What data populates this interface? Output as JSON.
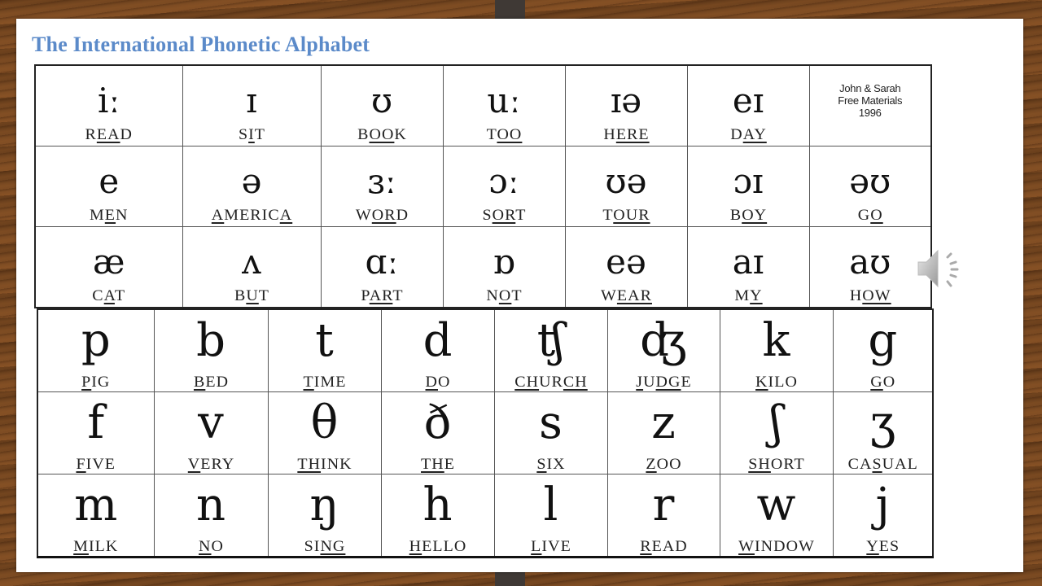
{
  "slide": {
    "title": "The International Phonetic Alphabet",
    "credit": [
      "John & Sarah",
      "Free Materials",
      "1996"
    ]
  },
  "vowels": [
    [
      {
        "symbol": "iː",
        "word": [
          "R",
          "EA",
          "D"
        ]
      },
      {
        "symbol": "ɪ",
        "word": [
          "S",
          "I",
          "T"
        ]
      },
      {
        "symbol": "ʊ",
        "word": [
          "B",
          "OO",
          "K"
        ]
      },
      {
        "symbol": "uː",
        "word": [
          "T",
          "OO",
          ""
        ]
      },
      {
        "symbol": "ɪə",
        "word": [
          "H",
          "ERE",
          ""
        ]
      },
      {
        "symbol": "eɪ",
        "word": [
          "D",
          "AY",
          ""
        ]
      },
      {
        "credit": true
      }
    ],
    [
      {
        "symbol": "e",
        "word": [
          "M",
          "E",
          "N"
        ]
      },
      {
        "symbol": "ə",
        "word": [
          "",
          "A",
          "MERIC",
          "A",
          ""
        ]
      },
      {
        "symbol": "ɜː",
        "word": [
          "W",
          "OR",
          "D"
        ]
      },
      {
        "symbol": "ɔː",
        "word": [
          "S",
          "OR",
          "T"
        ]
      },
      {
        "symbol": "ʊə",
        "word": [
          "T",
          "OUR",
          ""
        ]
      },
      {
        "symbol": "ɔɪ",
        "word": [
          "B",
          "OY",
          ""
        ]
      },
      {
        "symbol": "əʊ",
        "word": [
          "G",
          "O",
          ""
        ]
      }
    ],
    [
      {
        "symbol": "æ",
        "word": [
          "C",
          "A",
          "T"
        ]
      },
      {
        "symbol": "ʌ",
        "word": [
          "B",
          "U",
          "T"
        ]
      },
      {
        "symbol": "ɑː",
        "word": [
          "P",
          "AR",
          "T"
        ]
      },
      {
        "symbol": "ɒ",
        "word": [
          "N",
          "O",
          "T"
        ]
      },
      {
        "symbol": "eə",
        "word": [
          "W",
          "EAR",
          ""
        ]
      },
      {
        "symbol": "aɪ",
        "word": [
          "M",
          "Y",
          ""
        ]
      },
      {
        "symbol": "aʊ",
        "word": [
          "H",
          "OW",
          ""
        ]
      }
    ]
  ],
  "consonants": [
    [
      {
        "symbol": "p",
        "word": [
          "",
          "P",
          "IG"
        ]
      },
      {
        "symbol": "b",
        "word": [
          "",
          "B",
          "ED"
        ]
      },
      {
        "symbol": "t",
        "word": [
          "",
          "T",
          "IME"
        ]
      },
      {
        "symbol": "d",
        "word": [
          "",
          "D",
          "O"
        ]
      },
      {
        "symbol": "ʧ",
        "word": [
          "",
          "CH",
          "UR",
          "CH",
          ""
        ]
      },
      {
        "symbol": "ʤ",
        "word": [
          "",
          "J",
          "U",
          "DG",
          "E"
        ]
      },
      {
        "symbol": "k",
        "word": [
          "",
          "K",
          "ILO"
        ]
      },
      {
        "symbol": "g",
        "word": [
          "",
          "G",
          "O"
        ]
      }
    ],
    [
      {
        "symbol": "f",
        "word": [
          "",
          "F",
          "IVE"
        ]
      },
      {
        "symbol": "v",
        "word": [
          "",
          "V",
          "ERY"
        ]
      },
      {
        "symbol": "θ",
        "word": [
          "",
          "TH",
          "INK"
        ]
      },
      {
        "symbol": "ð",
        "word": [
          "",
          "TH",
          "E"
        ]
      },
      {
        "symbol": "s",
        "word": [
          "",
          "S",
          "IX"
        ]
      },
      {
        "symbol": "z",
        "word": [
          "",
          "Z",
          "OO"
        ]
      },
      {
        "symbol": "ʃ",
        "word": [
          "",
          "SH",
          "ORT"
        ]
      },
      {
        "symbol": "ʒ",
        "word": [
          "CA",
          "S",
          "UAL"
        ]
      }
    ],
    [
      {
        "symbol": "m",
        "word": [
          "",
          "M",
          "ILK"
        ]
      },
      {
        "symbol": "n",
        "word": [
          "",
          "N",
          "O"
        ]
      },
      {
        "symbol": "ŋ",
        "word": [
          "SI",
          "NG",
          ""
        ]
      },
      {
        "symbol": "h",
        "word": [
          "",
          "H",
          "ELLO"
        ]
      },
      {
        "symbol": "l",
        "word": [
          "",
          "L",
          "IVE"
        ]
      },
      {
        "symbol": "r",
        "word": [
          "",
          "R",
          "EAD"
        ]
      },
      {
        "symbol": "w",
        "word": [
          "",
          "W",
          "INDOW"
        ]
      },
      {
        "symbol": "j",
        "word": [
          "",
          "Y",
          "ES"
        ]
      }
    ]
  ],
  "audio": {
    "icon": "speaker-icon"
  }
}
